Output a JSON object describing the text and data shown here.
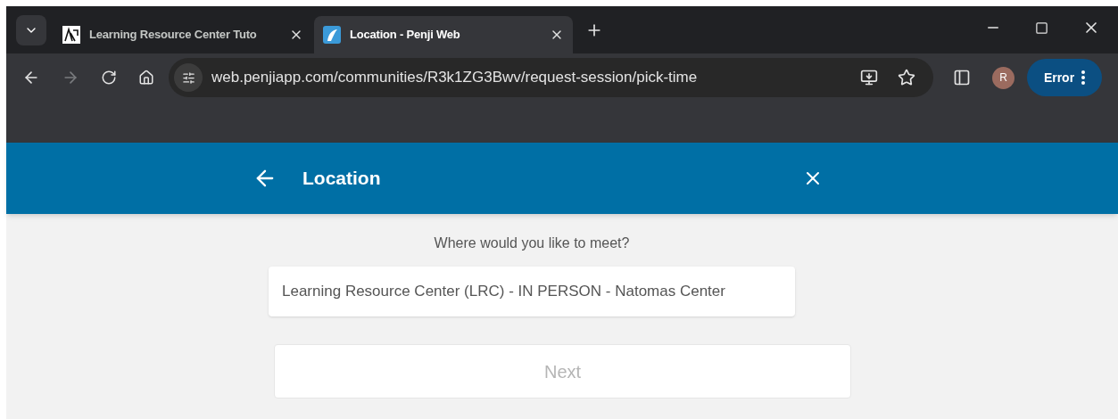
{
  "browser": {
    "tabs": [
      {
        "title": "Learning Resource Center Tuto",
        "selected": false,
        "kind": "lrc"
      },
      {
        "title": "Location - Penji Web",
        "selected": true,
        "kind": "penji"
      }
    ],
    "address": "web.penjiapp.com/communities/R3k1ZG3Bwv/request-session/pick-time",
    "profile_initial": "R",
    "error_button": "Error"
  },
  "header": {
    "title": "Location"
  },
  "question": "Where would you like to meet?",
  "location_field": {
    "value": "Learning Resource Center (LRC) - IN PERSON - Natomas Center"
  },
  "next_button": {
    "label": "Next",
    "disabled": true
  }
}
